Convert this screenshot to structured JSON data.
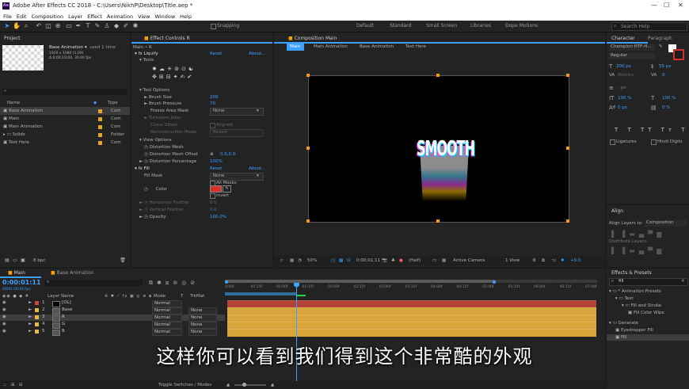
{
  "window": {
    "title": "Adobe After Effects CC 2018 - C:\\Users\\NikhP\\Desktop\\Title.aep *"
  },
  "menu": [
    "File",
    "Edit",
    "Composition",
    "Layer",
    "Effect",
    "Animation",
    "View",
    "Window",
    "Help"
  ],
  "toolbar": {
    "snapping": "Snapping",
    "search_help": "Search Help"
  },
  "workspaces": [
    "Default",
    "Standard",
    "Small Screen",
    "Libraries",
    "Dope Motions"
  ],
  "project": {
    "tab": "Project",
    "item_name": "Base Animation",
    "item_used": ", used 1 time",
    "item_dims": "1920 x 1080 (1.00)",
    "item_duration": "Δ 0;00;10;00, 30.00 fps",
    "col_name": "Name",
    "col_type": "Type",
    "items": [
      {
        "name": "Base Animation",
        "type": "Com"
      },
      {
        "name": "Main",
        "type": "Com"
      },
      {
        "name": "Main Animation",
        "type": "Com"
      },
      {
        "name": "Solids",
        "type": "Folder"
      },
      {
        "name": "Text Here",
        "type": "Com"
      }
    ],
    "bpc": "8 bpc"
  },
  "effects": {
    "tab": "Effect Controls R",
    "layer_path": "Main • R",
    "liquify": "Liquify",
    "reset": "Reset",
    "about": "About...",
    "tools": "Tools",
    "tool_options": "Tool Options",
    "brush_size_label": "Brush Size",
    "brush_size": "200",
    "brush_pressure_label": "Brush Pressure",
    "brush_pressure": "70",
    "freeze_area_label": "Freeze Area Mask",
    "freeze_area": "None",
    "turbulent_jitter": "Turbulent Jitter",
    "clone_offset": "Clone Offset",
    "aligned": "Aligned",
    "reconstruction_mode": "Reconstruction Mode",
    "revert": "Revert",
    "view_options": "View Options",
    "distortion_mesh": "Distortion Mesh",
    "distortion_mesh_offset": "Distortion Mesh Offset",
    "offset_value": "0.0,0.0",
    "distortion_pct_label": "Distortion Percentage",
    "distortion_pct": "100%",
    "fill": "Fill",
    "fill_mask_label": "Fill Mask",
    "fill_mask": "None",
    "all_masks": "All Masks",
    "color": "Color",
    "invert": "Invert",
    "horizontal_feather": "Horizontal Feather",
    "vertical_feather": "Vertical Feather",
    "feather_value": "0.0",
    "opacity_label": "Opacity",
    "opacity": "100.0%"
  },
  "composition": {
    "tab": "Composition Main",
    "breadcrumbs": [
      "Main",
      "Main Animation",
      "Base Animation",
      "Text Here"
    ],
    "art_text": "SMOOTH",
    "zoom": "50%",
    "timecode": "0;00;01;11",
    "resolution": "(Half)",
    "camera": "Active Camera",
    "views": "1 View",
    "exposure": "+0.0"
  },
  "character": {
    "tab": "Character",
    "tab2": "Paragraph",
    "font": "Champion HTF-H...",
    "style": "Regular",
    "size": "200 px",
    "leading": "55 px",
    "tracking": "Metrics",
    "kerning": "0",
    "stroke": "- px",
    "vscale": "100 %",
    "hscale": "100 %",
    "baseline": "0 px",
    "tsume": "0 %",
    "ligatures": "Ligatures",
    "hindi": "Hindi Digits"
  },
  "align": {
    "tab": "Align",
    "align_to_label": "Align Layers to:",
    "align_to": "Composition",
    "distribute": "Distribute Layers:"
  },
  "effects_presets": {
    "tab": "Effects & Presets",
    "search": "fill",
    "tree": [
      {
        "label": "* Animation Presets",
        "indent": 0
      },
      {
        "label": "Text",
        "indent": 1
      },
      {
        "label": "Fill and Stroke",
        "indent": 2
      },
      {
        "label": "Fill Color Wipe",
        "indent": 3
      },
      {
        "label": "Generate",
        "indent": 0
      },
      {
        "label": "Eyedropper Fill",
        "indent": 1
      },
      {
        "label": "Fill",
        "indent": 1
      }
    ]
  },
  "timeline": {
    "tabs": [
      "Main",
      "Base Animation"
    ],
    "timecode": "0:00:01:11",
    "frame": "00041 (30.00 fps)",
    "col_layer": "Layer Name",
    "col_mode": "Mode",
    "col_trkmat": "T",
    "col_trkmat2": "TrkMat",
    "col_parent": "Parent",
    "ticks": [
      "0;00f",
      "00:15f",
      "01:00f",
      "01:15f",
      "02:00f",
      "02:15f",
      "03:00f",
      "03:15f",
      "04:00f",
      "04:15f",
      "05:00f",
      "05:15f",
      "06:00f",
      "06:15f",
      "07:00f"
    ],
    "layers": [
      {
        "num": "1",
        "name": "[OL]",
        "mode": "Normal",
        "trk": "",
        "parent": "",
        "color": "#c94a3a"
      },
      {
        "num": "2",
        "name": "Base",
        "mode": "Normal",
        "trk": "None",
        "parent": "None",
        "color": "#e8b84a"
      },
      {
        "num": "3",
        "name": "R",
        "mode": "Normal",
        "trk": "None",
        "parent": "None",
        "color": "#e8b84a"
      },
      {
        "num": "4",
        "name": "G",
        "mode": "Normal",
        "trk": "None",
        "parent": "None",
        "color": "#e8b84a"
      },
      {
        "num": "5",
        "name": "B",
        "mode": "Normal",
        "trk": "None",
        "parent": "None",
        "color": "#e8b84a"
      }
    ],
    "toggle": "Toggle Switches / Modes"
  },
  "subtitle": "这样你可以看到我们得到这个非常酷的外观",
  "colors": {
    "accent": "#3ea0ff",
    "label_yellow": "#e0a826",
    "fill_red": "#d62f2f",
    "bar_red": "#b5433a",
    "bar_gold": "#d9a53a"
  }
}
